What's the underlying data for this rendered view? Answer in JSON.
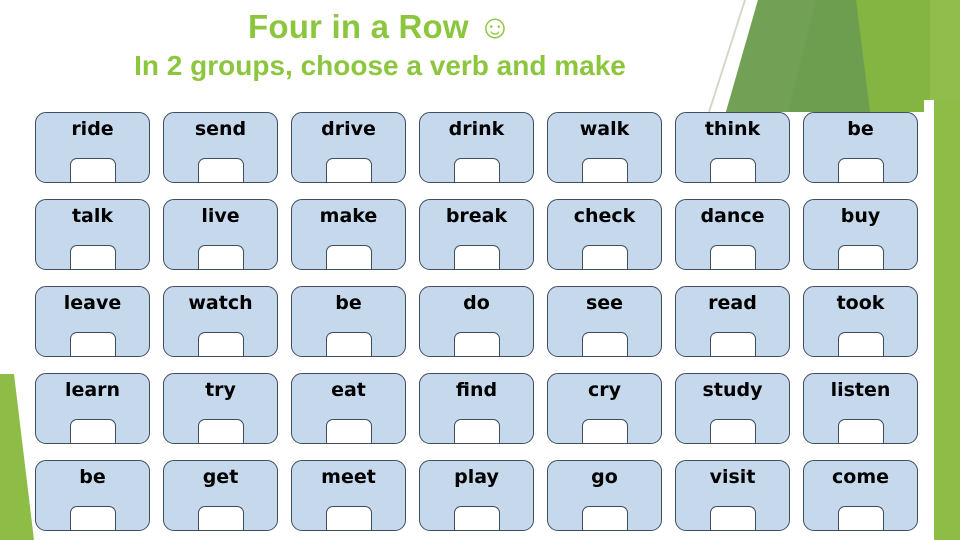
{
  "header": {
    "title": "Four in a Row ☺",
    "subtitle": "In 2 groups, choose a verb and make"
  },
  "colors": {
    "title_green": "#8cc63e",
    "accent_green_light": "#8dbc47",
    "accent_green_dark": "#6d9e50",
    "tile_fill": "#c6d9ec",
    "tile_border": "#3f4d5c",
    "door_fill": "#ffffff",
    "background": "#ffffff"
  },
  "grid": {
    "columns": 7,
    "rows": 5,
    "words": [
      [
        "ride",
        "send",
        "drive",
        "drink",
        "walk",
        "think",
        "be"
      ],
      [
        "talk",
        "live",
        "make",
        "break",
        "check",
        "dance",
        "buy"
      ],
      [
        "leave",
        "watch",
        "be",
        "do",
        "see",
        "read",
        "took"
      ],
      [
        "learn",
        "try",
        "eat",
        "find",
        "cry",
        "study",
        "listen"
      ],
      [
        "be",
        "get",
        "meet",
        "play",
        "go",
        "visit",
        "come"
      ]
    ]
  }
}
